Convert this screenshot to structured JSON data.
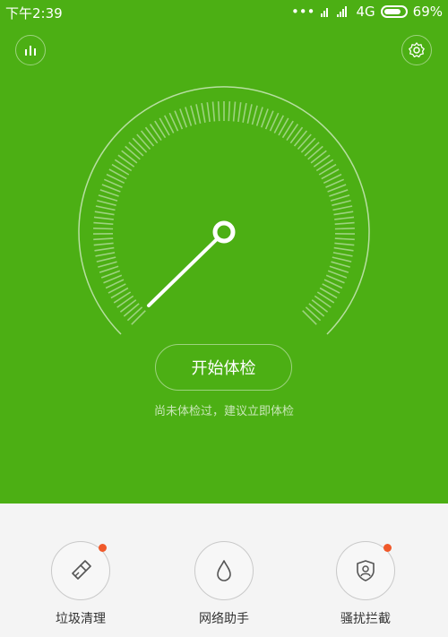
{
  "status": {
    "time": "下午2:39",
    "dots": "•••",
    "network": "4G",
    "battery": "69%"
  },
  "toolbar": {
    "left_icon": "bar-chart-icon",
    "right_icon": "gear-icon"
  },
  "main": {
    "button_label": "开始体检",
    "hint": "尚未体检过，建议立即体检",
    "gauge_level": 0
  },
  "tools": [
    {
      "label": "垃圾清理",
      "icon": "broom-icon",
      "badge": true
    },
    {
      "label": "网络助手",
      "icon": "drop-icon",
      "badge": false
    },
    {
      "label": "骚扰拦截",
      "icon": "shield-user-icon",
      "badge": true
    }
  ],
  "colors": {
    "primary": "#4caf14",
    "badge": "#f0592a"
  }
}
